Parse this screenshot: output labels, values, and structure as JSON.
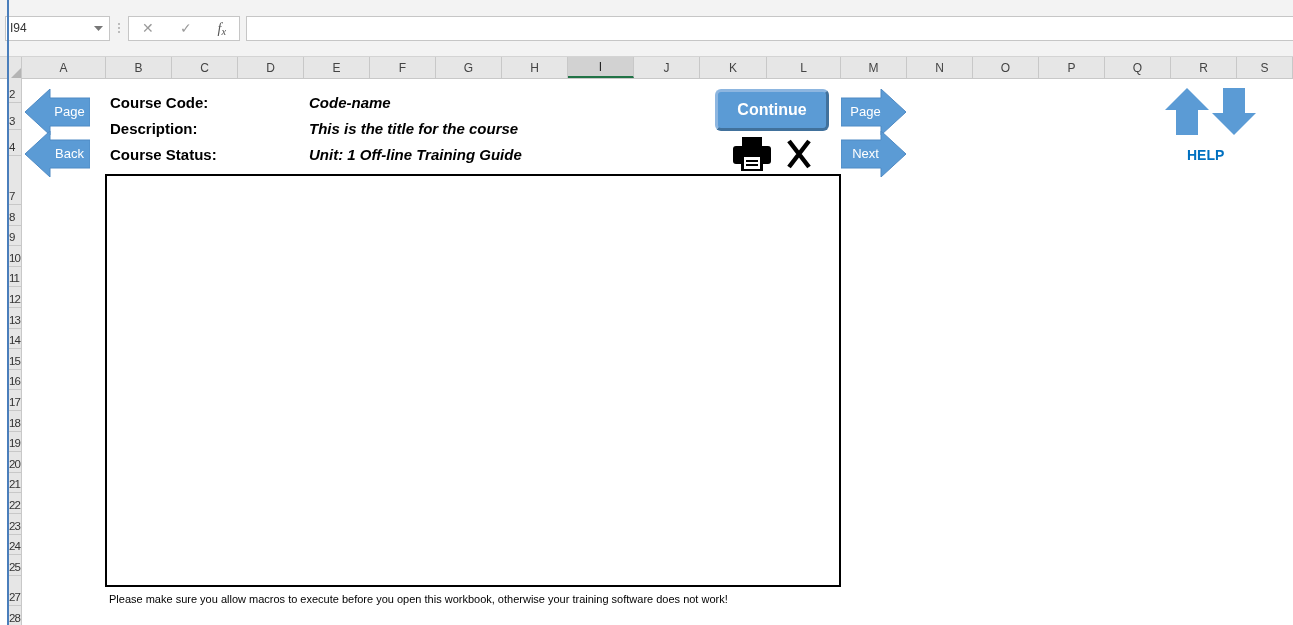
{
  "name_box": {
    "value": "I94"
  },
  "formula_bar": {
    "cancel_glyph": "✕",
    "enter_glyph": "✓",
    "function_label": "f$_{x}$"
  },
  "columns": [
    {
      "label": "A",
      "selected": false
    },
    {
      "label": "B",
      "selected": false
    },
    {
      "label": "C",
      "selected": false
    },
    {
      "label": "D",
      "selected": false
    },
    {
      "label": "E",
      "selected": false
    },
    {
      "label": "F",
      "selected": false
    },
    {
      "label": "G",
      "selected": false
    },
    {
      "label": "H",
      "selected": false
    },
    {
      "label": "I",
      "selected": true
    },
    {
      "label": "J",
      "selected": false
    },
    {
      "label": "K",
      "selected": false
    },
    {
      "label": "L",
      "selected": false
    },
    {
      "label": "M",
      "selected": false
    },
    {
      "label": "N",
      "selected": false
    },
    {
      "label": "O",
      "selected": false
    },
    {
      "label": "P",
      "selected": false
    },
    {
      "label": "Q",
      "selected": false
    },
    {
      "label": "R",
      "selected": false
    },
    {
      "label": "S",
      "selected": false
    }
  ],
  "rows": [
    "2",
    "3",
    "4",
    "7",
    "8",
    "9",
    "10",
    "11",
    "12",
    "13",
    "14",
    "15",
    "16",
    "17",
    "18",
    "19",
    "20",
    "21",
    "22",
    "23",
    "24",
    "25",
    "27",
    "28"
  ],
  "nav_left": [
    {
      "label": "Page"
    },
    {
      "label": "Back"
    }
  ],
  "fields": [
    {
      "label": "Course Code:",
      "value": "Code-name"
    },
    {
      "label": "Description:",
      "value": "This is the title for the course"
    },
    {
      "label": "Course Status:",
      "value": "Unit: 1  Off-line Training Guide"
    }
  ],
  "continue_button": {
    "label": "Continue"
  },
  "nav_right": [
    {
      "label": "Page"
    },
    {
      "label": "Next"
    }
  ],
  "help": {
    "label": "HELP"
  },
  "note": "Please make sure you allow macros to execute before you open this workbook, otherwise your training software does not work!"
}
